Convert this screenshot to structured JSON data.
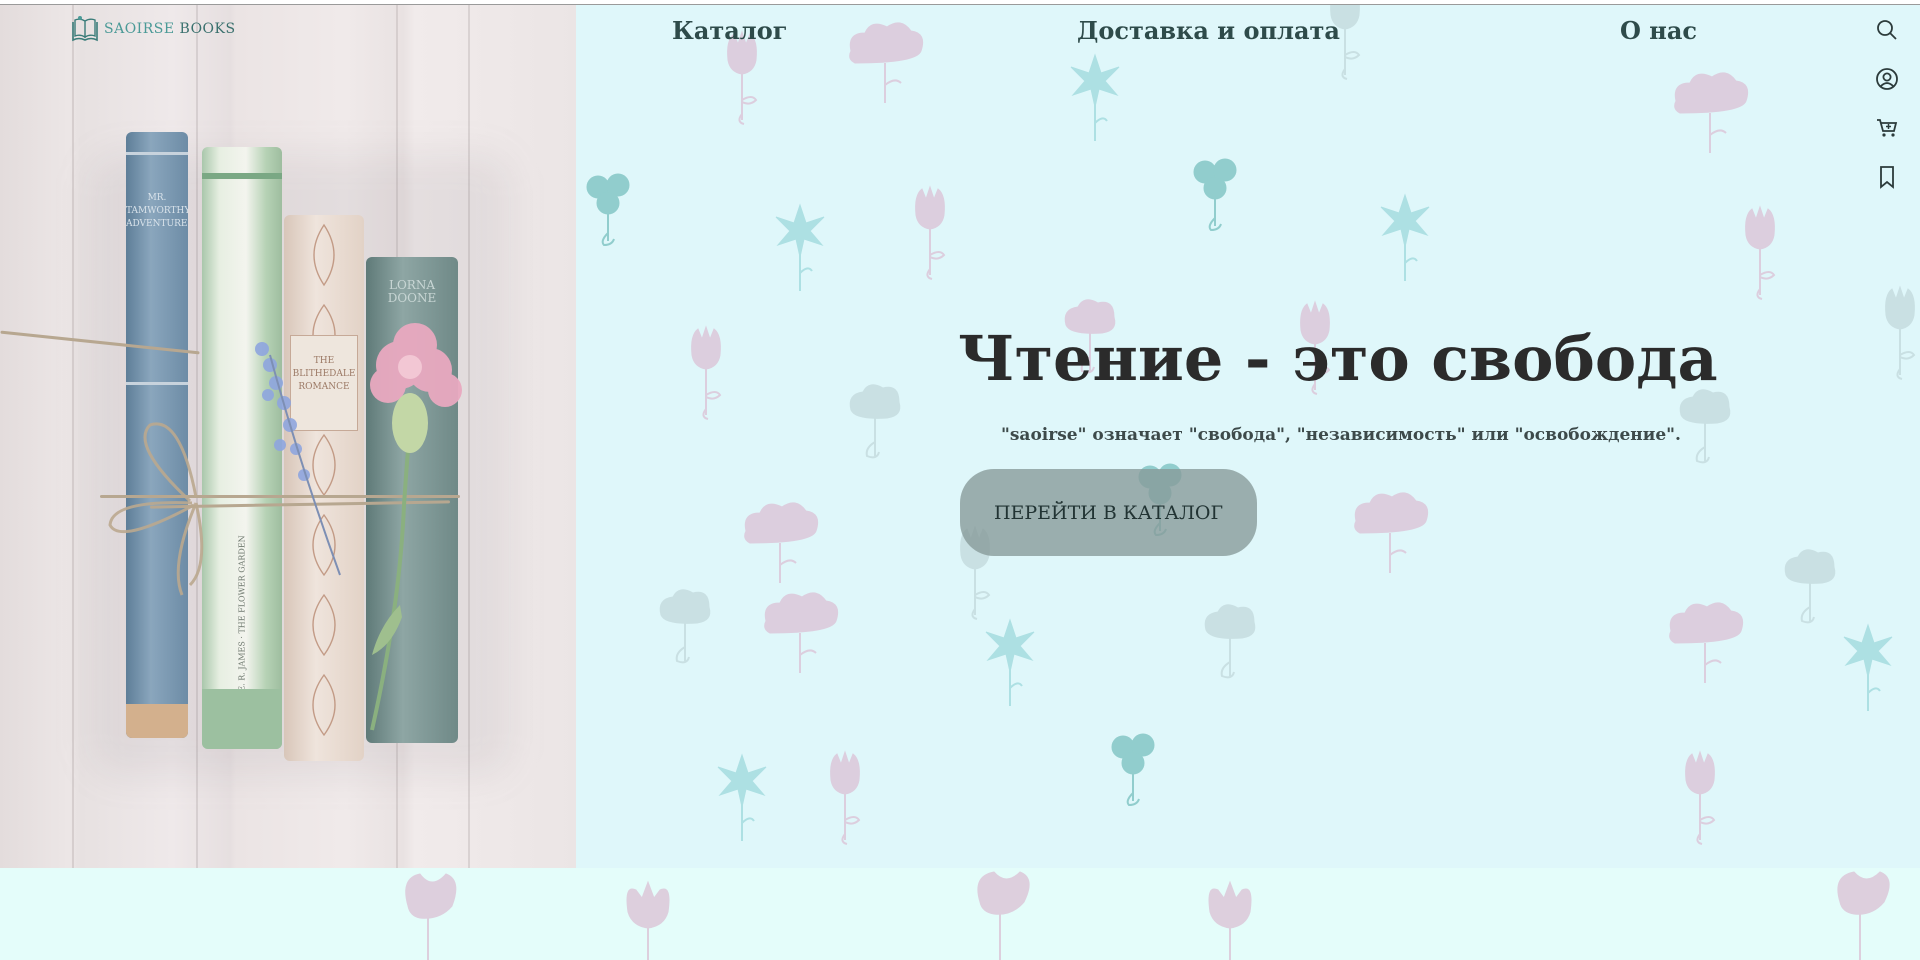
{
  "brand": {
    "name_part1": "SAOIRSE",
    "name_part2": "BOOKS",
    "icon": "book-logo-icon"
  },
  "nav": {
    "catalog": "Каталог",
    "delivery": "Доставка и оплата",
    "about": "О нас"
  },
  "toolbar_icons": [
    "search-icon",
    "user-icon",
    "cart-icon",
    "bookmark-icon"
  ],
  "hero": {
    "title": "Чтение - это свобода",
    "subtitle": "\"saoirse\" означает \"свобода\", \"независимость\" или \"освобождение\".",
    "cta_label": "ПЕРЕЙТИ В КАТАЛОГ"
  },
  "photo": {
    "book_spines": [
      "MR. TAMWORTHY'S ADVENTURES",
      "E. R. JAMES · THE FLOWER GARDEN",
      "THE BLITHEDALE ROMANCE",
      "LORNA DOONE"
    ]
  },
  "colors": {
    "hero_background": "#dff7fa",
    "brand_teal": "#4b9a97",
    "nav_text": "#2e4b4a",
    "cta_background": "#869a98"
  }
}
